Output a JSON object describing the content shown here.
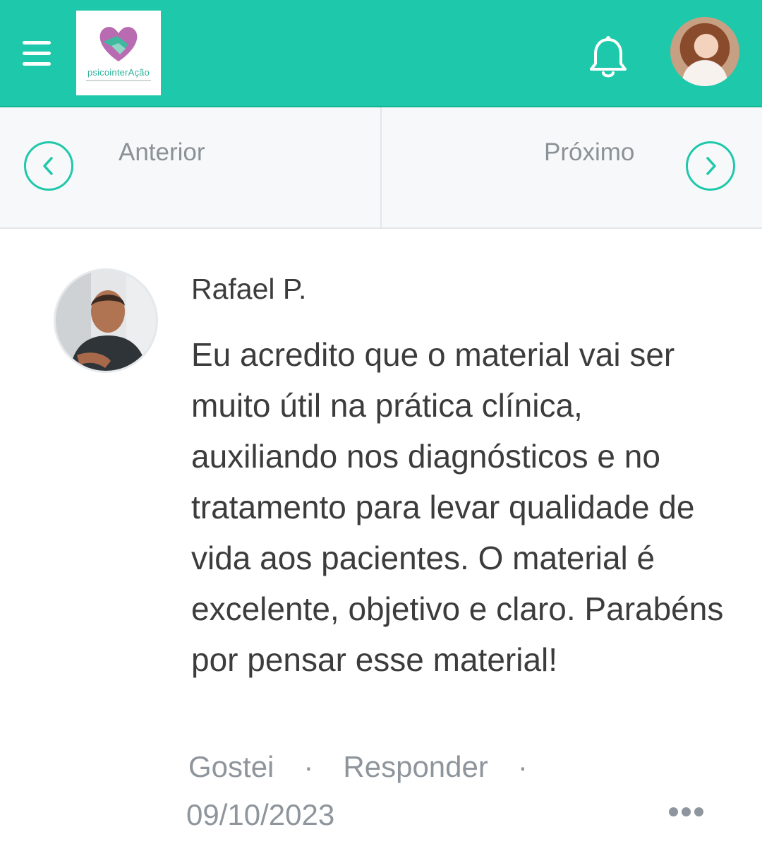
{
  "header": {
    "logo_text": "psicointerAção",
    "menu_icon": "hamburger-menu-icon",
    "notification_icon": "bell-icon",
    "brand_color": "#1ec8aa"
  },
  "navigation": {
    "previous_label": "Anterior",
    "next_label": "Próximo"
  },
  "comment": {
    "author": "Rafael P.",
    "text": "Eu acredito que o material vai ser muito útil na prática clínica, auxiliando nos diagnósticos e no tratamento para levar qualidade de vida aos pacientes. O material é excelente, objetivo e claro. Parabéns por pensar esse material!",
    "like_label": "Gostei",
    "reply_label": "Responder",
    "separator": "·",
    "date": "09/10/2023"
  }
}
